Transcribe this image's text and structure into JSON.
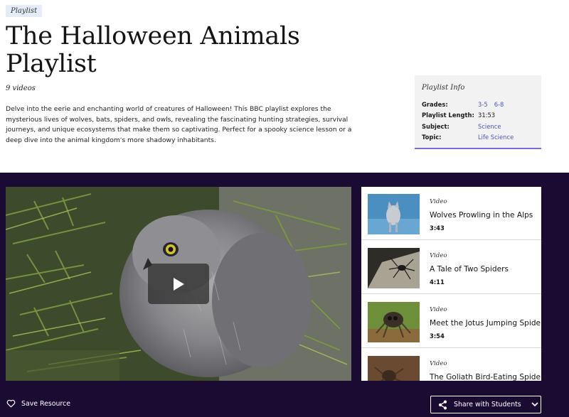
{
  "header": {
    "badge": "Playlist",
    "title": "The Halloween Animals Playlist",
    "count": "9 videos",
    "description": "Delve into the eerie and enchanting world of creatures of Halloween! This BBC playlist explores the mysterious lives of wolves, bats, spiders, and owls, revealing the fascinating hunting strategies, survival journeys, and unique ecosystems that make them so captivating. Perfect for a spooky science lesson or a deep dive into the animal kingdom's more shadowy inhabitants."
  },
  "info": {
    "title": "Playlist Info",
    "grades_label": "Grades:",
    "grades": [
      "3-5",
      "6-8"
    ],
    "length_label": "Playlist Length:",
    "length": "31:53",
    "subject_label": "Subject:",
    "subject": "Science",
    "topic_label": "Topic:",
    "topic": "Life Science"
  },
  "player": {
    "play_icon": "play-icon"
  },
  "videos": [
    {
      "type": "Video",
      "title": "Wolves Prowling in the Alps",
      "duration": "3:43"
    },
    {
      "type": "Video",
      "title": "A Tale of Two Spiders",
      "duration": "4:11"
    },
    {
      "type": "Video",
      "title": "Meet the Jotus Jumping Spider",
      "duration": "3:54"
    },
    {
      "type": "Video",
      "title": "The Goliath Bird-Eating Spider",
      "duration": ""
    }
  ],
  "footer": {
    "save_label": "Save Resource",
    "share_label": "Share with Students"
  },
  "colors": {
    "band": "#1a0b33",
    "accent": "#7b6bd6",
    "link": "#4b54c8"
  }
}
